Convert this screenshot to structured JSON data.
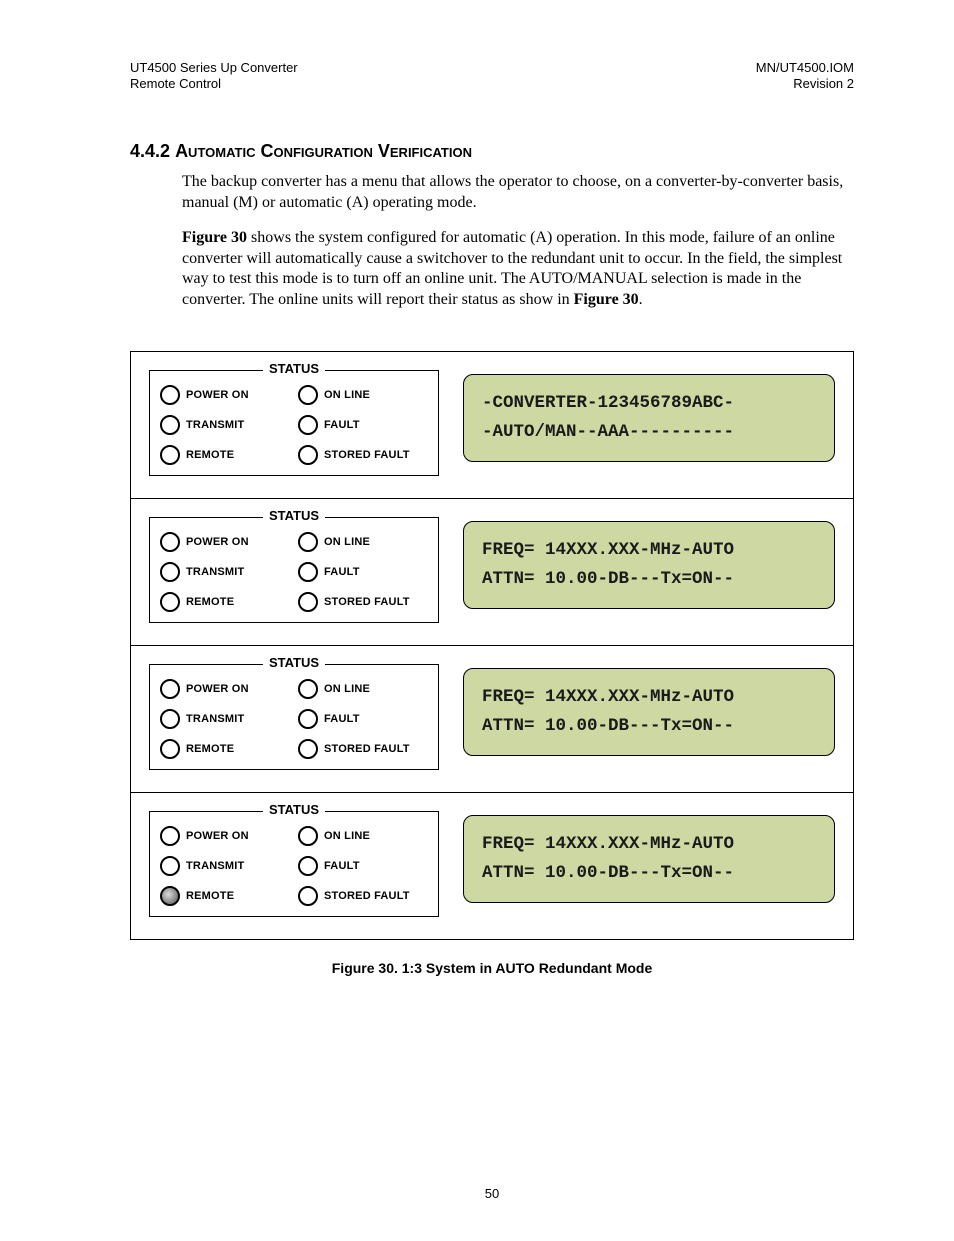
{
  "header": {
    "left_line1": "UT4500 Series Up Converter",
    "left_line2": "Remote Control",
    "right_line1": "MN/UT4500.IOM",
    "right_line2": "Revision 2"
  },
  "section": {
    "number": "4.4.2",
    "title": "Automatic Configuration Verification"
  },
  "paragraphs": {
    "p1": "The backup converter has a menu that allows the operator to choose, on a converter-by-converter basis, manual (M) or automatic (A) operating mode.",
    "p2a": "Figure 30",
    "p2b": " shows the system configured for automatic (A) operation.  In this mode, failure of an online converter will automatically cause a switchover to the redundant unit to occur.  In the field, the simplest way to test this mode is to turn off an online unit. The AUTO/MANUAL selection is made in the converter. The online units will report their status as show in ",
    "p2c": "Figure 30",
    "p2d": "."
  },
  "status_legend_title": "Status",
  "leds": {
    "power_on": "Power On",
    "on_line": "On Line",
    "transmit": "Transmit",
    "fault": "Fault",
    "remote": "Remote",
    "stored_fault": "Stored Fault"
  },
  "panels": [
    {
      "remote_on": false,
      "lcd_line1": "-CONVERTER-123456789ABC-",
      "lcd_line2": "-AUTO/MAN--AAA----------"
    },
    {
      "remote_on": false,
      "lcd_line1": "FREQ= 14XXX.XXX-MHz-AUTO",
      "lcd_line2": "ATTN= 10.00-DB---Tx=ON--"
    },
    {
      "remote_on": false,
      "lcd_line1": "FREQ= 14XXX.XXX-MHz-AUTO",
      "lcd_line2": "ATTN= 10.00-DB---Tx=ON--"
    },
    {
      "remote_on": true,
      "lcd_line1": "FREQ= 14XXX.XXX-MHz-AUTO",
      "lcd_line2": "ATTN= 10.00-DB---Tx=ON--"
    }
  ],
  "figure_caption": "Figure 30.  1:3 System in AUTO Redundant Mode",
  "page_number": "50"
}
